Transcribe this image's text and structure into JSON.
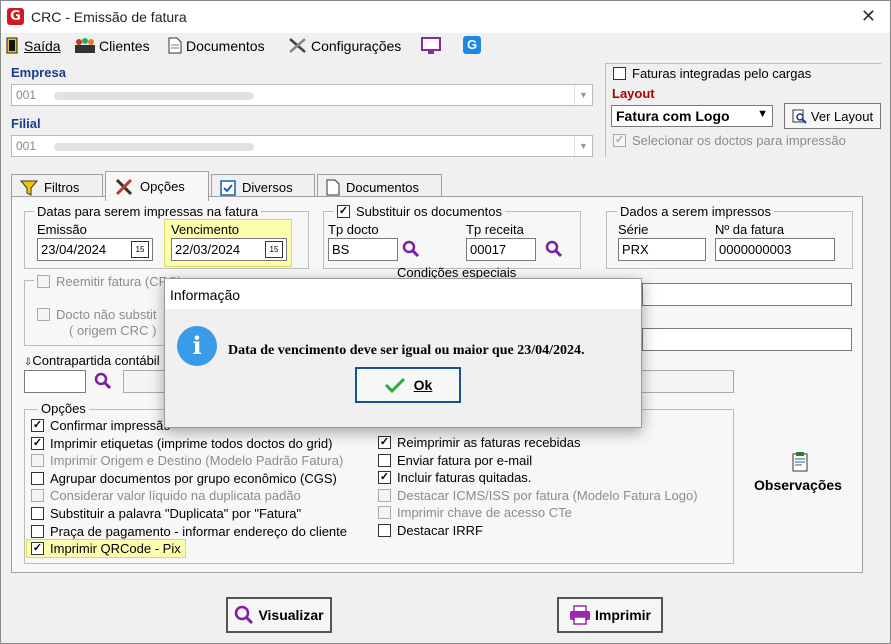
{
  "window": {
    "title": "CRC - Emissão de fatura",
    "logo": "G"
  },
  "menu": [
    {
      "label": "Saída",
      "icon": "exit-door-icon"
    },
    {
      "label": "Clientes",
      "icon": "users-icon"
    },
    {
      "label": "Documentos",
      "icon": "document-icon"
    },
    {
      "label": "Configurações",
      "icon": "tools-icon"
    }
  ],
  "empresa": {
    "label": "Empresa",
    "value": "001"
  },
  "filial": {
    "label": "Filial",
    "value": "001"
  },
  "right_top": {
    "faturas_integradas": "Faturas integradas pelo cargas",
    "layout_label": "Layout",
    "layout_value": "Fatura com Logo",
    "ver_layout": "Ver Layout",
    "selecionar_doctos": "Selecionar os doctos para impressão"
  },
  "tabs": [
    {
      "label": "Filtros",
      "icon": "filter-icon"
    },
    {
      "label": "Opções",
      "icon": "tools-icon"
    },
    {
      "label": "Diversos",
      "icon": "checkbox-icon"
    },
    {
      "label": "Documentos",
      "icon": "document-icon"
    }
  ],
  "datas": {
    "legend": "Datas para serem impressas na fatura",
    "emissao_label": "Emissão",
    "emissao_value": "23/04/2024",
    "vencimento_label": "Vencimento",
    "vencimento_value": "22/03/2024",
    "cal_text": "15"
  },
  "substituir": {
    "legend": "Substituir os documentos",
    "tp_docto_label": "Tp docto",
    "tp_docto_value": "BS",
    "tp_receita_label": "Tp receita",
    "tp_receita_value": "00017"
  },
  "dados": {
    "legend": "Dados a serem impressos",
    "serie_label": "Série",
    "serie_value": "PRX",
    "nfatura_label": "Nº da fatura",
    "nfatura_value": "0000000003"
  },
  "reemitir": "Reemitir fatura (CRC)",
  "docto_nao": "Docto não substit",
  "origem_crc": "( origem CRC )",
  "condicoes": "Condições especiais",
  "contrapartida": "Contrapartida contábil",
  "opcoes": {
    "legend": "Opções",
    "left": [
      {
        "label": "Confirmar impressão",
        "checked": true,
        "disabled": false
      },
      {
        "label": "Imprimir etiquetas (imprime todos doctos do grid)",
        "checked": true,
        "disabled": false
      },
      {
        "label": "Imprimir Origem e Destino (Modelo Padrão Fatura)",
        "checked": false,
        "disabled": true
      },
      {
        "label": "Agrupar documentos por grupo econômico (CGS)",
        "checked": false,
        "disabled": false
      },
      {
        "label": "Considerar valor líquido na duplicata padão",
        "checked": false,
        "disabled": true
      },
      {
        "label": "Substituir a palavra \"Duplicata\" por \"Fatura\"",
        "checked": false,
        "disabled": false
      },
      {
        "label": "Praça de pagamento - informar endereço do cliente",
        "checked": false,
        "disabled": false
      },
      {
        "label": "Imprimir QRCode - Pix",
        "checked": true,
        "disabled": false
      }
    ],
    "right": [
      {
        "label": "Reimprimir as faturas recebidas",
        "checked": true,
        "disabled": false
      },
      {
        "label": "Enviar fatura por e-mail",
        "checked": false,
        "disabled": false
      },
      {
        "label": "Incluir faturas quitadas.",
        "checked": true,
        "disabled": false
      },
      {
        "label": "Destacar ICMS/ISS por fatura (Modelo Fatura Logo)",
        "checked": false,
        "disabled": true
      },
      {
        "label": "Imprimir chave de acesso CTe",
        "checked": false,
        "disabled": true
      },
      {
        "label": "Destacar IRRF",
        "checked": false,
        "disabled": false
      }
    ],
    "observacoes": "Observações"
  },
  "buttons": {
    "visualizar": "Visualizar",
    "imprimir": "Imprimir"
  },
  "dialog": {
    "title": "Informação",
    "message": "Data de vencimento deve ser igual ou maior que 23/04/2024.",
    "ok": "Ok",
    "icon_text": "i"
  }
}
